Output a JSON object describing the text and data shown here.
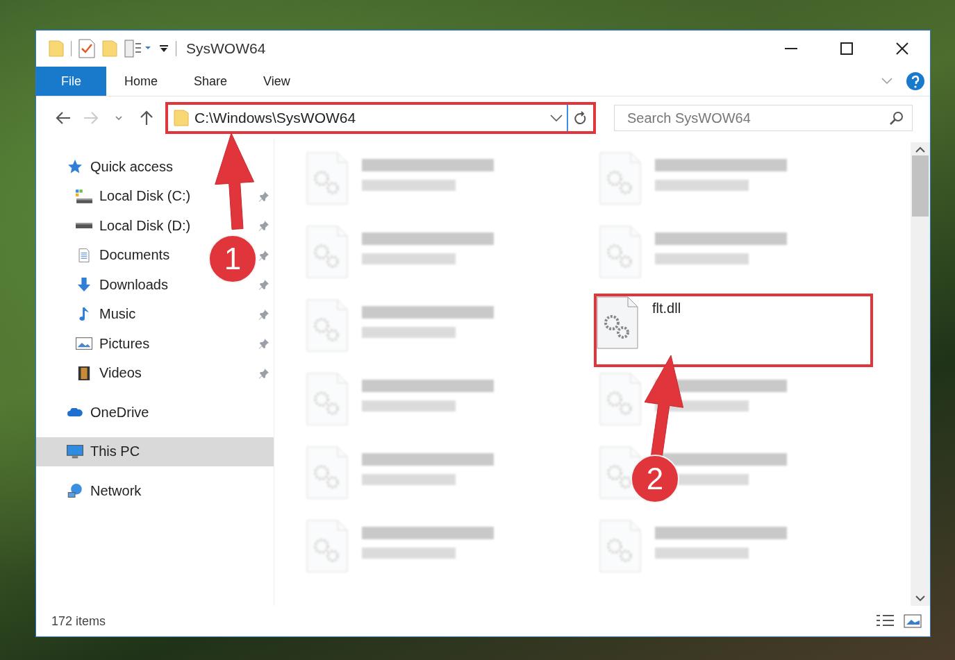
{
  "window": {
    "title": "SysWOW64"
  },
  "ribbon_tabs": [
    {
      "label": "File",
      "selected": true
    },
    {
      "label": "Home",
      "selected": false
    },
    {
      "label": "Share",
      "selected": false
    },
    {
      "label": "View",
      "selected": false
    }
  ],
  "address_bar": {
    "value": "C:\\Windows\\SysWOW64",
    "highlighted": true
  },
  "search": {
    "placeholder": "Search SysWOW64"
  },
  "sidebar": {
    "items": [
      {
        "label": "Quick access",
        "selected": false,
        "children": [
          {
            "label": "Local Disk (C:)",
            "pinned": true
          },
          {
            "label": "Local Disk (D:)",
            "pinned": true
          },
          {
            "label": "Documents",
            "pinned": true
          },
          {
            "label": "Downloads",
            "pinned": true
          },
          {
            "label": "Music",
            "pinned": true
          },
          {
            "label": "Pictures",
            "pinned": true
          },
          {
            "label": "Videos",
            "pinned": true
          }
        ]
      },
      {
        "label": "OneDrive",
        "selected": false
      },
      {
        "label": "This PC",
        "selected": true
      },
      {
        "label": "Network",
        "selected": false
      }
    ]
  },
  "files": [
    {
      "blurred": true,
      "highlighted": false
    },
    {
      "blurred": true,
      "highlighted": false
    },
    {
      "blurred": true,
      "highlighted": false
    },
    {
      "blurred": true,
      "highlighted": false
    },
    {
      "blurred": true,
      "highlighted": false
    },
    {
      "name": "flt.dll",
      "blurred": false,
      "highlighted": true
    },
    {
      "blurred": true,
      "highlighted": false
    },
    {
      "blurred": true,
      "highlighted": false
    },
    {
      "blurred": true,
      "highlighted": false
    },
    {
      "blurred": true,
      "highlighted": false
    },
    {
      "blurred": true,
      "highlighted": false
    },
    {
      "blurred": true,
      "highlighted": false
    }
  ],
  "status_bar": {
    "item_count": "172 items"
  },
  "annotations": [
    {
      "label": "1"
    },
    {
      "label": "2"
    }
  ]
}
